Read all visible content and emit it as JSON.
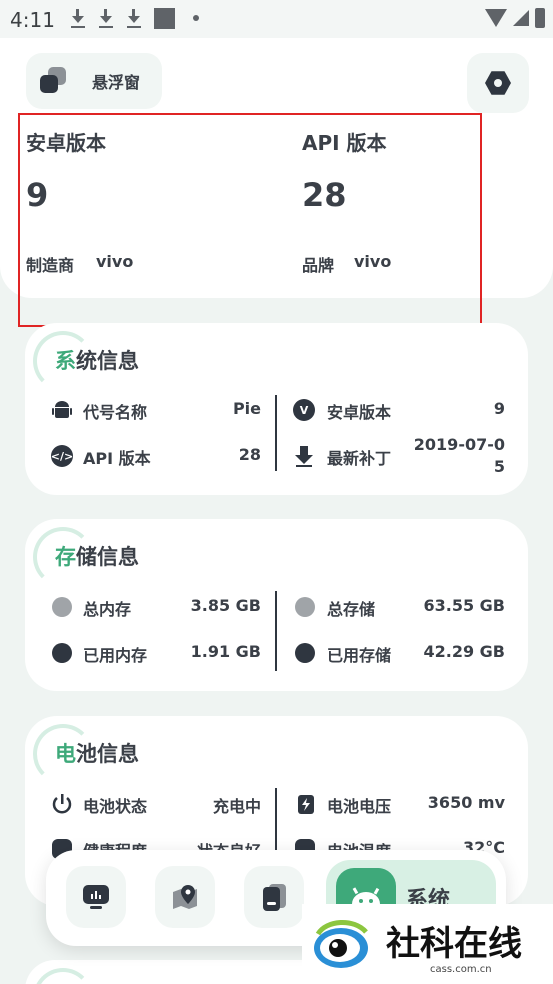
{
  "status_bar": {
    "time": "4:11"
  },
  "header": {
    "float_window_label": "悬浮窗"
  },
  "top_info": {
    "android_version_label": "安卓版本",
    "android_version_value": "9",
    "api_label": "API 版本",
    "api_value": "28",
    "manufacturer_label": "制造商",
    "manufacturer_value": "vivo",
    "brand_label": "品牌",
    "brand_value": "vivo"
  },
  "system_card": {
    "title_accent": "系",
    "title_rest": "统信息",
    "rows": [
      {
        "label": "代号名称",
        "value": "Pie",
        "icon": "android-icon"
      },
      {
        "label": "安卓版本",
        "value": "9",
        "icon": "v-badge-icon"
      },
      {
        "label": "API 版本",
        "value": "28",
        "icon": "code-icon"
      },
      {
        "label": "最新补丁",
        "value": "2019-07-0\n5",
        "icon": "download-patch-icon"
      }
    ]
  },
  "storage_card": {
    "title_accent": "存",
    "title_rest": "储信息",
    "rows": [
      {
        "label": "总内存",
        "value": "3.85 GB"
      },
      {
        "label": "总存储",
        "value": "63.55 GB"
      },
      {
        "label": "已用内存",
        "value": "1.91 GB"
      },
      {
        "label": "已用存储",
        "value": "42.29 GB"
      }
    ]
  },
  "battery_card": {
    "title_accent": "电",
    "title_rest": "池信息",
    "rows": [
      {
        "label": "电池状态",
        "value": "充电中",
        "icon": "power-icon"
      },
      {
        "label": "电池电压",
        "value": "3650 mv",
        "icon": "battery-bolt-icon"
      },
      {
        "label": "健康程度",
        "value": "状态良好",
        "icon": "health-icon"
      },
      {
        "label": "电池温度",
        "value": "32°C",
        "icon": "thermometer-icon"
      }
    ]
  },
  "bottom_nav": {
    "items": [
      {
        "icon": "monitor-icon"
      },
      {
        "icon": "location-icon"
      },
      {
        "icon": "storage-icon"
      }
    ],
    "active_label": "系统"
  },
  "watermark": {
    "text": "社科在线",
    "url": "cass.com.cn"
  },
  "colors": {
    "accent": "#3ea97a",
    "highlight_box": "#e02424",
    "dark": "#2f3640"
  }
}
